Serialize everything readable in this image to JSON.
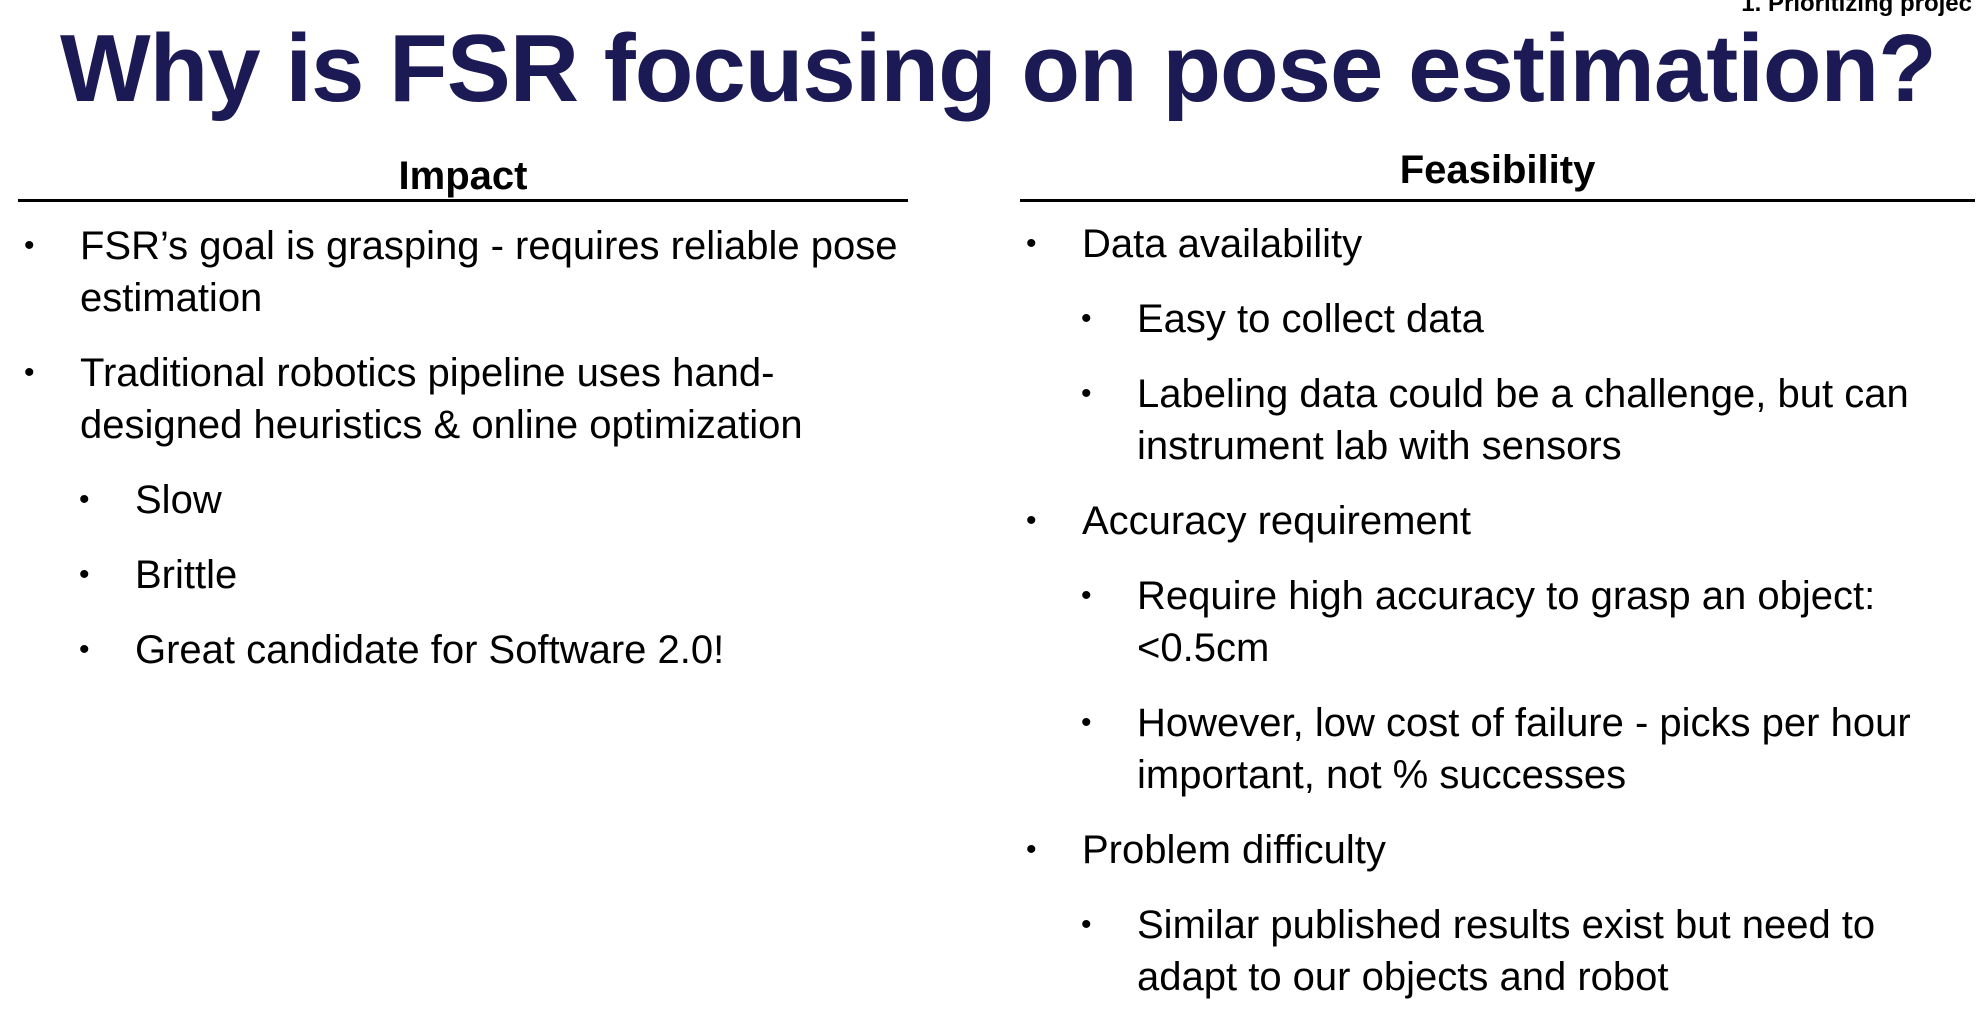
{
  "corner_label": "1. Prioritizing projec",
  "title": "Why is FSR focusing on pose estimation?",
  "impact": {
    "header": "Impact",
    "bullets": [
      {
        "level": 1,
        "text": "FSR’s goal is grasping - requires reliable pose estimation"
      },
      {
        "level": 1,
        "text": "Traditional robotics pipeline uses hand-designed heuristics & online optimization"
      },
      {
        "level": 2,
        "text": "Slow"
      },
      {
        "level": 2,
        "text": "Brittle"
      },
      {
        "level": 2,
        "text": "Great candidate for Software 2.0!"
      }
    ]
  },
  "feasibility": {
    "header": "Feasibility",
    "bullets": [
      {
        "level": 1,
        "text": "Data availability"
      },
      {
        "level": 2,
        "text": "Easy to collect data"
      },
      {
        "level": 2,
        "text": "Labeling data could be a challenge, but can instrument lab with sensors"
      },
      {
        "level": 1,
        "text": "Accuracy requirement"
      },
      {
        "level": 2,
        "text": "Require high accuracy to grasp an object: <0.5cm"
      },
      {
        "level": 2,
        "text": "However, low cost of failure - picks per hour important, not % successes"
      },
      {
        "level": 1,
        "text": "Problem difficulty"
      },
      {
        "level": 2,
        "text": "Similar published results exist but need to adapt to our objects and robot"
      }
    ]
  },
  "colors": {
    "title": "#1c1a55",
    "text": "#000000",
    "background": "#ffffff"
  }
}
